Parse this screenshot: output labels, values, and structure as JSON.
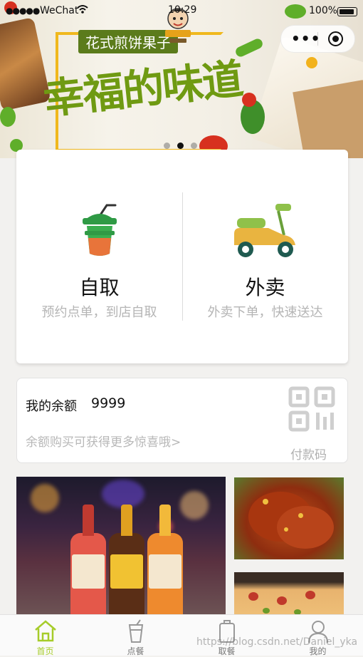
{
  "status_bar": {
    "carrier": "WeChat",
    "time": "10:29",
    "battery": "100%"
  },
  "banner": {
    "tag": "花式煎饼果子",
    "slogan": "幸福的味道",
    "active_slide": 2,
    "slide_count": 3
  },
  "services": [
    {
      "title": "自取",
      "subtitle": "预约点单，到店自取",
      "icon": "drink-cup-icon"
    },
    {
      "title": "外卖",
      "subtitle": "外卖下单，快速送达",
      "icon": "scooter-icon"
    }
  ],
  "balance": {
    "label": "我的余额",
    "value": "9999",
    "promo": "余额购买可获得更多惊喜哦>",
    "qr_label": "付款码"
  },
  "tabbar": {
    "items": [
      {
        "label": "首页",
        "icon": "home-icon",
        "active": true
      },
      {
        "label": "点餐",
        "icon": "cup-icon",
        "active": false
      },
      {
        "label": "取餐",
        "icon": "bag-icon",
        "active": false
      },
      {
        "label": "我的",
        "icon": "user-icon",
        "active": false
      }
    ]
  },
  "watermark": "https://blog.csdn.net/Daniel_yka",
  "colors": {
    "accent": "#a6cc29",
    "slogan_green": "#6f9a12",
    "frame_yellow": "#f0b81d"
  }
}
